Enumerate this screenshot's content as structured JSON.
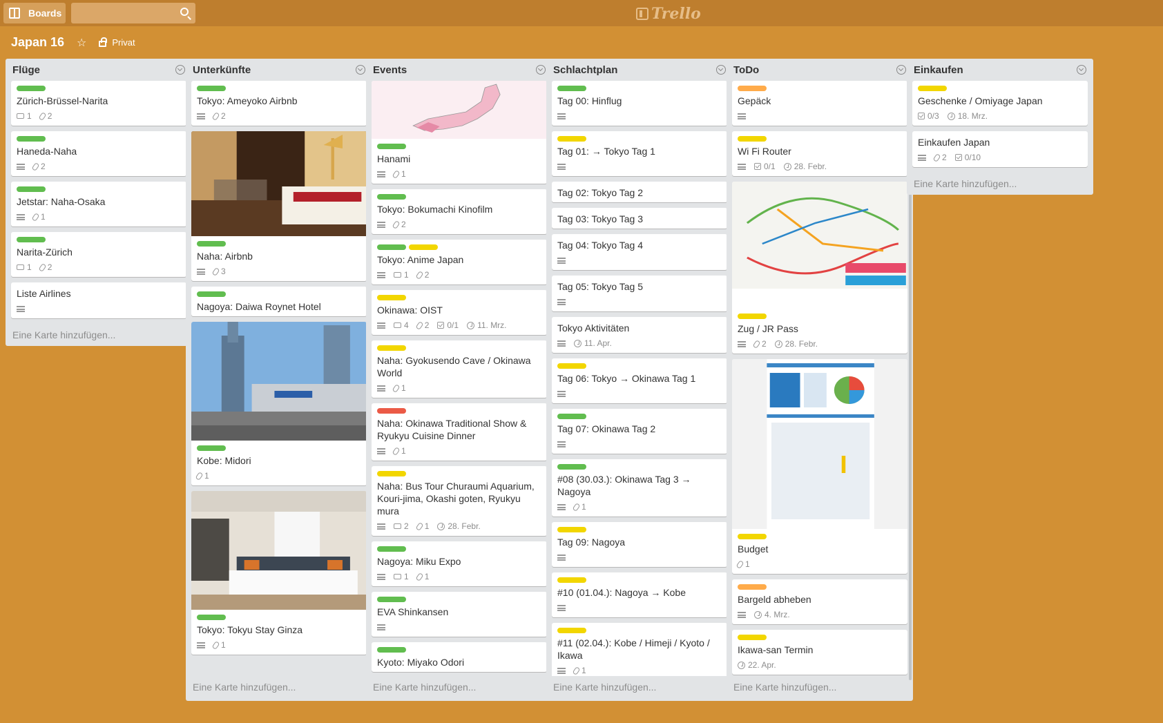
{
  "header": {
    "boards_label": "Boards",
    "search_placeholder": "",
    "logo_text": "Trello"
  },
  "board": {
    "title": "Japan 16",
    "visibility": "Privat"
  },
  "add_card_label": "Eine Karte hinzufügen...",
  "colors": {
    "background": "#d29034",
    "green": "#61bd4f",
    "yellow": "#f2d600",
    "orange": "#ffab4a",
    "red": "#eb5a46"
  },
  "lists": [
    {
      "title": "Flüge",
      "cards": [
        {
          "labels": [
            "green"
          ],
          "title": "Zürich-Brüssel-Narita",
          "badges": [
            {
              "icon": "comment-icon",
              "text": "1"
            },
            {
              "icon": "attachment-icon",
              "text": "2"
            }
          ]
        },
        {
          "labels": [
            "green"
          ],
          "title": "Haneda-Naha",
          "badges": [
            {
              "icon": "description-icon",
              "text": ""
            },
            {
              "icon": "attachment-icon",
              "text": "2"
            }
          ]
        },
        {
          "labels": [
            "green"
          ],
          "title": "Jetstar: Naha-Osaka",
          "badges": [
            {
              "icon": "description-icon",
              "text": ""
            },
            {
              "icon": "attachment-icon",
              "text": "1"
            }
          ]
        },
        {
          "labels": [
            "green"
          ],
          "title": "Narita-Zürich",
          "badges": [
            {
              "icon": "comment-icon",
              "text": "1"
            },
            {
              "icon": "attachment-icon",
              "text": "2"
            }
          ]
        },
        {
          "labels": [],
          "title": "Liste Airlines",
          "badges": [
            {
              "icon": "description-icon",
              "text": ""
            }
          ]
        }
      ]
    },
    {
      "title": "Unterkünfte",
      "cards": [
        {
          "labels": [
            "green"
          ],
          "title": "Tokyo: Ameyoko Airbnb",
          "badges": [
            {
              "icon": "description-icon",
              "text": ""
            },
            {
              "icon": "attachment-icon",
              "text": "2"
            }
          ]
        },
        {
          "cover": "room",
          "labels": [
            "green"
          ],
          "title": "Naha: Airbnb",
          "badges": [
            {
              "icon": "description-icon",
              "text": ""
            },
            {
              "icon": "attachment-icon",
              "text": "3"
            }
          ]
        },
        {
          "labels": [
            "green"
          ],
          "title": "Nagoya: Daiwa Roynet Hotel",
          "badges": []
        },
        {
          "cover": "city",
          "labels": [
            "green"
          ],
          "title": "Kobe: Midori",
          "badges": [
            {
              "icon": "attachment-icon",
              "text": "1"
            }
          ]
        },
        {
          "cover": "hotel",
          "labels": [
            "green"
          ],
          "title": "Tokyo: Tokyu Stay Ginza",
          "badges": [
            {
              "icon": "description-icon",
              "text": ""
            },
            {
              "icon": "attachment-icon",
              "text": "1"
            }
          ]
        }
      ]
    },
    {
      "title": "Events",
      "cards": [
        {
          "cover": "sakura",
          "labels": [
            "green"
          ],
          "title": "Hanami",
          "badges": [
            {
              "icon": "description-icon",
              "text": ""
            },
            {
              "icon": "attachment-icon",
              "text": "1"
            }
          ]
        },
        {
          "labels": [
            "green"
          ],
          "title": "Tokyo: Bokumachi Kinofilm",
          "badges": [
            {
              "icon": "description-icon",
              "text": ""
            },
            {
              "icon": "attachment-icon",
              "text": "2"
            }
          ]
        },
        {
          "labels": [
            "green",
            "yellow"
          ],
          "title": "Tokyo: Anime Japan",
          "badges": [
            {
              "icon": "description-icon",
              "text": ""
            },
            {
              "icon": "comment-icon",
              "text": "1"
            },
            {
              "icon": "attachment-icon",
              "text": "2"
            }
          ]
        },
        {
          "labels": [
            "yellow"
          ],
          "title": "Okinawa: OIST",
          "badges": [
            {
              "icon": "description-icon",
              "text": ""
            },
            {
              "icon": "comment-icon",
              "text": "4"
            },
            {
              "icon": "attachment-icon",
              "text": "2"
            },
            {
              "icon": "checklist-icon",
              "text": "0/1"
            },
            {
              "icon": "clock-icon",
              "text": "11. Mrz."
            }
          ]
        },
        {
          "labels": [
            "yellow"
          ],
          "title": "Naha: Gyokusendo Cave / Okinawa World",
          "badges": [
            {
              "icon": "description-icon",
              "text": ""
            },
            {
              "icon": "attachment-icon",
              "text": "1"
            }
          ]
        },
        {
          "labels": [
            "red"
          ],
          "title": "Naha: Okinawa Traditional Show & Ryukyu Cuisine Dinner",
          "badges": [
            {
              "icon": "description-icon",
              "text": ""
            },
            {
              "icon": "attachment-icon",
              "text": "1"
            }
          ]
        },
        {
          "labels": [
            "yellow"
          ],
          "title": "Naha: Bus Tour Churaumi Aquarium, Kouri-jima, Okashi goten, Ryukyu mura",
          "badges": [
            {
              "icon": "description-icon",
              "text": ""
            },
            {
              "icon": "comment-icon",
              "text": "2"
            },
            {
              "icon": "attachment-icon",
              "text": "1"
            },
            {
              "icon": "clock-icon",
              "text": "28. Febr."
            }
          ]
        },
        {
          "labels": [
            "green"
          ],
          "title": "Nagoya: Miku Expo",
          "badges": [
            {
              "icon": "description-icon",
              "text": ""
            },
            {
              "icon": "comment-icon",
              "text": "1"
            },
            {
              "icon": "attachment-icon",
              "text": "1"
            }
          ]
        },
        {
          "labels": [
            "green"
          ],
          "title": "EVA Shinkansen",
          "badges": [
            {
              "icon": "description-icon",
              "text": ""
            }
          ]
        },
        {
          "labels": [
            "green"
          ],
          "title": "Kyoto: Miyako Odori",
          "badges": []
        }
      ]
    },
    {
      "title": "Schlachtplan",
      "cards": [
        {
          "labels": [
            "green"
          ],
          "title": "Tag 00: Hinflug",
          "badges": [
            {
              "icon": "description-icon",
              "text": ""
            }
          ]
        },
        {
          "labels": [
            "yellow"
          ],
          "title": "Tag 01: → Tokyo Tag 1",
          "badges": [
            {
              "icon": "description-icon",
              "text": ""
            }
          ]
        },
        {
          "labels": [],
          "title": "Tag 02: Tokyo Tag 2",
          "badges": []
        },
        {
          "labels": [],
          "title": "Tag 03: Tokyo Tag 3",
          "badges": []
        },
        {
          "labels": [],
          "title": "Tag 04: Tokyo Tag 4",
          "badges": [
            {
              "icon": "description-icon",
              "text": ""
            }
          ]
        },
        {
          "labels": [],
          "title": "Tag 05: Tokyo Tag 5",
          "badges": [
            {
              "icon": "description-icon",
              "text": ""
            }
          ]
        },
        {
          "labels": [],
          "title": "Tokyo Aktivitäten",
          "badges": [
            {
              "icon": "description-icon",
              "text": ""
            },
            {
              "icon": "clock-icon",
              "text": "11. Apr."
            }
          ]
        },
        {
          "labels": [
            "yellow"
          ],
          "title": "Tag 06: Tokyo → Okinawa Tag 1",
          "badges": [
            {
              "icon": "description-icon",
              "text": ""
            }
          ]
        },
        {
          "labels": [
            "green"
          ],
          "title": "Tag 07: Okinawa Tag 2",
          "badges": [
            {
              "icon": "description-icon",
              "text": ""
            }
          ]
        },
        {
          "labels": [
            "green"
          ],
          "title": "#08 (30.03.): Okinawa Tag 3 → Nagoya",
          "badges": [
            {
              "icon": "description-icon",
              "text": ""
            },
            {
              "icon": "attachment-icon",
              "text": "1"
            }
          ]
        },
        {
          "labels": [
            "yellow"
          ],
          "title": "Tag 09: Nagoya",
          "badges": [
            {
              "icon": "description-icon",
              "text": ""
            }
          ]
        },
        {
          "labels": [
            "yellow"
          ],
          "title": "#10 (01.04.): Nagoya → Kobe",
          "badges": [
            {
              "icon": "description-icon",
              "text": ""
            }
          ]
        },
        {
          "labels": [
            "yellow"
          ],
          "title": "#11 (02.04.): Kobe / Himeji / Kyoto / Ikawa",
          "badges": [
            {
              "icon": "description-icon",
              "text": ""
            },
            {
              "icon": "attachment-icon",
              "text": "1"
            }
          ]
        }
      ]
    },
    {
      "title": "ToDo",
      "cards": [
        {
          "labels": [
            "orange"
          ],
          "title": "Gepäck",
          "badges": [
            {
              "icon": "description-icon",
              "text": ""
            }
          ]
        },
        {
          "labels": [
            "yellow"
          ],
          "title": "Wi Fi Router",
          "badges": [
            {
              "icon": "description-icon",
              "text": ""
            },
            {
              "icon": "checklist-icon",
              "text": "0/1"
            },
            {
              "icon": "clock-icon",
              "text": "28. Febr."
            }
          ]
        },
        {
          "cover": "map",
          "labels": [
            "yellow"
          ],
          "title": "Zug / JR Pass",
          "badges": [
            {
              "icon": "description-icon",
              "text": ""
            },
            {
              "icon": "attachment-icon",
              "text": "2"
            },
            {
              "icon": "clock-icon",
              "text": "28. Febr."
            }
          ]
        },
        {
          "cover": "budget",
          "labels": [
            "yellow"
          ],
          "title": "Budget",
          "badges": [
            {
              "icon": "attachment-icon",
              "text": "1"
            }
          ]
        },
        {
          "labels": [
            "orange"
          ],
          "title": "Bargeld abheben",
          "badges": [
            {
              "icon": "description-icon",
              "text": ""
            },
            {
              "icon": "clock-icon",
              "text": "4. Mrz."
            }
          ]
        },
        {
          "labels": [
            "yellow"
          ],
          "title": "Ikawa-san Termin",
          "badges": [
            {
              "icon": "clock-icon",
              "text": "22. Apr."
            }
          ]
        }
      ]
    },
    {
      "title": "Einkaufen",
      "cards": [
        {
          "labels": [
            "yellow"
          ],
          "title": "Geschenke / Omiyage Japan",
          "badges": [
            {
              "icon": "checklist-icon",
              "text": "0/3"
            },
            {
              "icon": "clock-icon",
              "text": "18. Mrz."
            }
          ]
        },
        {
          "labels": [],
          "title": "Einkaufen Japan",
          "badges": [
            {
              "icon": "description-icon",
              "text": ""
            },
            {
              "icon": "attachment-icon",
              "text": "2"
            },
            {
              "icon": "checklist-icon",
              "text": "0/10"
            }
          ]
        }
      ]
    }
  ]
}
